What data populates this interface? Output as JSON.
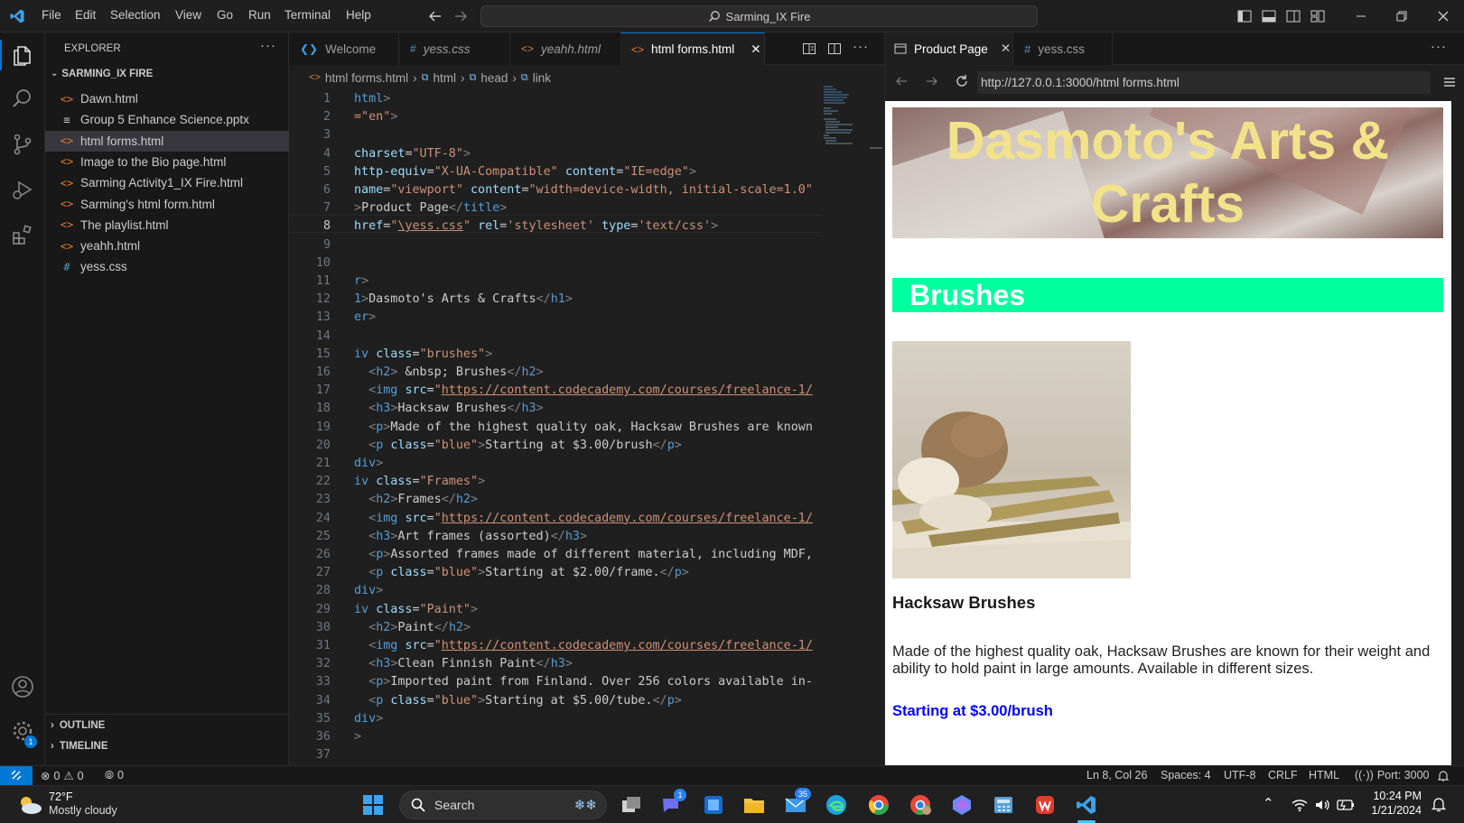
{
  "titlebar": {
    "menus": [
      "File",
      "Edit",
      "Selection",
      "View",
      "Go",
      "Run",
      "Terminal",
      "Help"
    ],
    "search_text": "Sarming_IX Fire"
  },
  "sidebar": {
    "title": "EXPLORER",
    "folder": "SARMING_IX FIRE",
    "files": [
      {
        "name": "Dawn.html",
        "icon": "html-file-icon",
        "glyph": "<>"
      },
      {
        "name": "Group 5 Enhance Science.pptx",
        "icon": "document-file-icon",
        "glyph": "≡"
      },
      {
        "name": "html forms.html",
        "icon": "html-file-icon",
        "glyph": "<>"
      },
      {
        "name": "Image to the Bio page.html",
        "icon": "html-file-icon",
        "glyph": "<>"
      },
      {
        "name": "Sarming Activity1_IX Fire.html",
        "icon": "html-file-icon",
        "glyph": "<>"
      },
      {
        "name": "Sarming's html form.html",
        "icon": "html-file-icon",
        "glyph": "<>"
      },
      {
        "name": "The playlist.html",
        "icon": "html-file-icon",
        "glyph": "<>"
      },
      {
        "name": "yeahh.html",
        "icon": "html-file-icon",
        "glyph": "<>"
      },
      {
        "name": "yess.css",
        "icon": "css-file-icon",
        "glyph": "#"
      }
    ],
    "outline_label": "OUTLINE",
    "timeline_label": "TIMELINE"
  },
  "editor": {
    "tabs": [
      {
        "label": "Welcome",
        "glyph": "❮❯"
      },
      {
        "label": "yess.css",
        "glyph": "#"
      },
      {
        "label": "yeahh.html",
        "glyph": "<>"
      },
      {
        "label": "html forms.html",
        "glyph": "<>"
      }
    ],
    "breadcrumb": [
      "html forms.html",
      "html",
      "head",
      "link"
    ],
    "lines": [
      [
        [
          "t",
          "html"
        ],
        [
          "g",
          ">"
        ]
      ],
      [
        [
          "s",
          "=\"en\""
        ],
        [
          "g",
          ">"
        ]
      ],
      [],
      [
        [
          "a",
          "charset"
        ],
        [
          "c",
          "="
        ],
        [
          "s",
          "\"UTF-8\""
        ],
        [
          "g",
          ">"
        ]
      ],
      [
        [
          "a",
          "http-equiv"
        ],
        [
          "c",
          "="
        ],
        [
          "s",
          "\"X-UA-Compatible\""
        ],
        [
          "c",
          " "
        ],
        [
          "a",
          "content"
        ],
        [
          "c",
          "="
        ],
        [
          "s",
          "\"IE=edge\""
        ],
        [
          "g",
          ">"
        ]
      ],
      [
        [
          "a",
          "name"
        ],
        [
          "c",
          "="
        ],
        [
          "s",
          "\"viewport\""
        ],
        [
          "c",
          " "
        ],
        [
          "a",
          "content"
        ],
        [
          "c",
          "="
        ],
        [
          "s",
          "\"width=device-width, initial-scale=1.0\""
        ]
      ],
      [
        [
          "g",
          ">"
        ],
        [
          "c",
          "Product Page"
        ],
        [
          "g",
          "</"
        ],
        [
          "t",
          "title"
        ],
        [
          "g",
          ">"
        ]
      ],
      [
        [
          "a",
          "href"
        ],
        [
          "c",
          "="
        ],
        [
          "s",
          "\""
        ],
        [
          "u",
          "\\yess.css"
        ],
        [
          "s",
          "\""
        ],
        [
          "c",
          " "
        ],
        [
          "a",
          "rel"
        ],
        [
          "c",
          "="
        ],
        [
          "s",
          "'stylesheet'"
        ],
        [
          "c",
          " "
        ],
        [
          "a",
          "type"
        ],
        [
          "c",
          "="
        ],
        [
          "s",
          "'text/css'"
        ],
        [
          "g",
          ">"
        ]
      ],
      [],
      [],
      [
        [
          "t",
          "r"
        ],
        [
          "g",
          ">"
        ]
      ],
      [
        [
          "t",
          "1"
        ],
        [
          "g",
          ">"
        ],
        [
          "c",
          "Dasmoto's Arts & Crafts"
        ],
        [
          "g",
          "</"
        ],
        [
          "t",
          "h1"
        ],
        [
          "g",
          ">"
        ]
      ],
      [
        [
          "t",
          "er"
        ],
        [
          "g",
          ">"
        ]
      ],
      [],
      [
        [
          "t",
          "iv"
        ],
        [
          "c",
          " "
        ],
        [
          "a",
          "class"
        ],
        [
          "c",
          "="
        ],
        [
          "s",
          "\"brushes\""
        ],
        [
          "g",
          ">"
        ]
      ],
      [
        [
          "c",
          "  "
        ],
        [
          "g",
          "<"
        ],
        [
          "t",
          "h2"
        ],
        [
          "g",
          ">"
        ],
        [
          "c",
          " &nbsp; Brushes"
        ],
        [
          "g",
          "</"
        ],
        [
          "t",
          "h2"
        ],
        [
          "g",
          ">"
        ]
      ],
      [
        [
          "c",
          "  "
        ],
        [
          "g",
          "<"
        ],
        [
          "t",
          "img"
        ],
        [
          "c",
          " "
        ],
        [
          "a",
          "src"
        ],
        [
          "c",
          "="
        ],
        [
          "s",
          "\""
        ],
        [
          "u",
          "https://content.codecademy.com/courses/freelance-1/"
        ]
      ],
      [
        [
          "c",
          "  "
        ],
        [
          "g",
          "<"
        ],
        [
          "t",
          "h3"
        ],
        [
          "g",
          ">"
        ],
        [
          "c",
          "Hacksaw Brushes"
        ],
        [
          "g",
          "</"
        ],
        [
          "t",
          "h3"
        ],
        [
          "g",
          ">"
        ]
      ],
      [
        [
          "c",
          "  "
        ],
        [
          "g",
          "<"
        ],
        [
          "t",
          "p"
        ],
        [
          "g",
          ">"
        ],
        [
          "c",
          "Made of the highest quality oak, Hacksaw Brushes are known"
        ]
      ],
      [
        [
          "c",
          "  "
        ],
        [
          "g",
          "<"
        ],
        [
          "t",
          "p"
        ],
        [
          "c",
          " "
        ],
        [
          "a",
          "class"
        ],
        [
          "c",
          "="
        ],
        [
          "s",
          "\"blue\""
        ],
        [
          "g",
          ">"
        ],
        [
          "c",
          "Starting at $3.00/brush"
        ],
        [
          "g",
          "</"
        ],
        [
          "t",
          "p"
        ],
        [
          "g",
          ">"
        ]
      ],
      [
        [
          "t",
          "div"
        ],
        [
          "g",
          ">"
        ]
      ],
      [
        [
          "t",
          "iv"
        ],
        [
          "c",
          " "
        ],
        [
          "a",
          "class"
        ],
        [
          "c",
          "="
        ],
        [
          "s",
          "\"Frames\""
        ],
        [
          "g",
          ">"
        ]
      ],
      [
        [
          "c",
          "  "
        ],
        [
          "g",
          "<"
        ],
        [
          "t",
          "h2"
        ],
        [
          "g",
          ">"
        ],
        [
          "c",
          "Frames"
        ],
        [
          "g",
          "</"
        ],
        [
          "t",
          "h2"
        ],
        [
          "g",
          ">"
        ]
      ],
      [
        [
          "c",
          "  "
        ],
        [
          "g",
          "<"
        ],
        [
          "t",
          "img"
        ],
        [
          "c",
          " "
        ],
        [
          "a",
          "src"
        ],
        [
          "c",
          "="
        ],
        [
          "s",
          "\""
        ],
        [
          "u",
          "https://content.codecademy.com/courses/freelance-1/"
        ]
      ],
      [
        [
          "c",
          "  "
        ],
        [
          "g",
          "<"
        ],
        [
          "t",
          "h3"
        ],
        [
          "g",
          ">"
        ],
        [
          "c",
          "Art frames (assorted)"
        ],
        [
          "g",
          "</"
        ],
        [
          "t",
          "h3"
        ],
        [
          "g",
          ">"
        ]
      ],
      [
        [
          "c",
          "  "
        ],
        [
          "g",
          "<"
        ],
        [
          "t",
          "p"
        ],
        [
          "g",
          ">"
        ],
        [
          "c",
          "Assorted frames made of different material, including MDF,"
        ]
      ],
      [
        [
          "c",
          "  "
        ],
        [
          "g",
          "<"
        ],
        [
          "t",
          "p"
        ],
        [
          "c",
          " "
        ],
        [
          "a",
          "class"
        ],
        [
          "c",
          "="
        ],
        [
          "s",
          "\"blue\""
        ],
        [
          "g",
          ">"
        ],
        [
          "c",
          "Starting at $2.00/frame."
        ],
        [
          "g",
          "</"
        ],
        [
          "t",
          "p"
        ],
        [
          "g",
          ">"
        ]
      ],
      [
        [
          "t",
          "div"
        ],
        [
          "g",
          ">"
        ]
      ],
      [
        [
          "t",
          "iv"
        ],
        [
          "c",
          " "
        ],
        [
          "a",
          "class"
        ],
        [
          "c",
          "="
        ],
        [
          "s",
          "\"Paint\""
        ],
        [
          "g",
          ">"
        ]
      ],
      [
        [
          "c",
          "  "
        ],
        [
          "g",
          "<"
        ],
        [
          "t",
          "h2"
        ],
        [
          "g",
          ">"
        ],
        [
          "c",
          "Paint"
        ],
        [
          "g",
          "</"
        ],
        [
          "t",
          "h2"
        ],
        [
          "g",
          ">"
        ]
      ],
      [
        [
          "c",
          "  "
        ],
        [
          "g",
          "<"
        ],
        [
          "t",
          "img"
        ],
        [
          "c",
          " "
        ],
        [
          "a",
          "src"
        ],
        [
          "c",
          "="
        ],
        [
          "s",
          "\""
        ],
        [
          "u",
          "https://content.codecademy.com/courses/freelance-1/"
        ]
      ],
      [
        [
          "c",
          "  "
        ],
        [
          "g",
          "<"
        ],
        [
          "t",
          "h3"
        ],
        [
          "g",
          ">"
        ],
        [
          "c",
          "Clean Finnish Paint"
        ],
        [
          "g",
          "</"
        ],
        [
          "t",
          "h3"
        ],
        [
          "g",
          ">"
        ]
      ],
      [
        [
          "c",
          "  "
        ],
        [
          "g",
          "<"
        ],
        [
          "t",
          "p"
        ],
        [
          "g",
          ">"
        ],
        [
          "c",
          "Imported paint from Finland. Over 256 colors available in-"
        ]
      ],
      [
        [
          "c",
          "  "
        ],
        [
          "g",
          "<"
        ],
        [
          "t",
          "p"
        ],
        [
          "c",
          " "
        ],
        [
          "a",
          "class"
        ],
        [
          "c",
          "="
        ],
        [
          "s",
          "\"blue\""
        ],
        [
          "g",
          ">"
        ],
        [
          "c",
          "Starting at $5.00/tube."
        ],
        [
          "g",
          "</"
        ],
        [
          "t",
          "p"
        ],
        [
          "g",
          ">"
        ]
      ],
      [
        [
          "t",
          "div"
        ],
        [
          "g",
          ">"
        ]
      ],
      [
        [
          "g",
          ">"
        ]
      ],
      []
    ],
    "current_line": 8
  },
  "preview": {
    "tabs": [
      {
        "label": "Product Page"
      },
      {
        "label": "yess.css"
      }
    ],
    "url": "http://127.0.0.1:3000/html forms.html",
    "page": {
      "h1": "Dasmoto's Arts & Crafts",
      "h2": "Brushes",
      "h3": "Hacksaw Brushes",
      "description": "Made of the highest quality oak, Hacksaw Brushes are known for their weight and ability to hold paint in large amounts. Available in different sizes.",
      "price": "Starting at $3.00/brush"
    }
  },
  "status": {
    "errors": "0",
    "warnings": "0",
    "ports": "0",
    "position": "Ln 8, Col 26",
    "spaces": "Spaces: 4",
    "encoding": "UTF-8",
    "eol": "CRLF",
    "language": "HTML",
    "port": "Port: 3000",
    "settings_badge": "1"
  },
  "taskbar": {
    "weather_temp": "72°F",
    "weather_desc": "Mostly cloudy",
    "search_label": "Search",
    "time": "10:24 PM",
    "date": "1/21/2024",
    "teams_badge": "1",
    "mail_badge": "35"
  },
  "colors": {
    "accent": "#0078d4",
    "brush_heading_bg": "#00ff9f",
    "header_text": "#f2e38a",
    "price_text": "#0000ff"
  }
}
